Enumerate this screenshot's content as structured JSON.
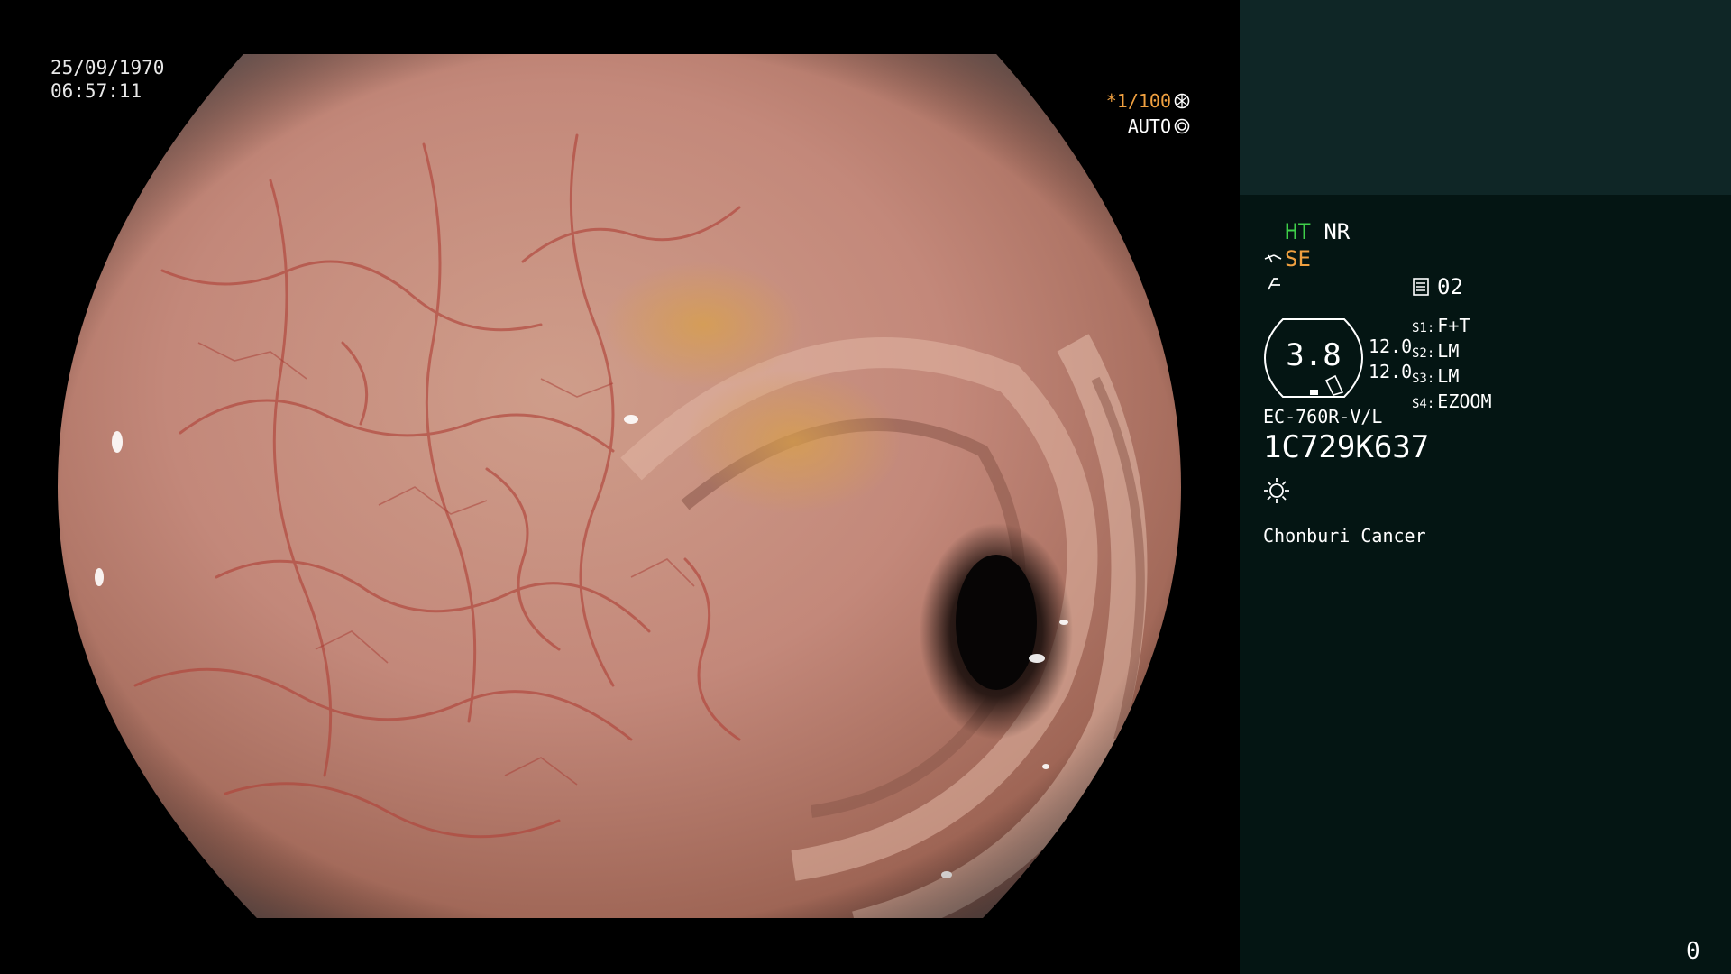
{
  "overlay": {
    "date": "25/09/1970",
    "time": "06:57:11",
    "shutter": "*1/100",
    "iris_mode": "AUTO"
  },
  "panel": {
    "ht": "HT",
    "nr": "NR",
    "se": "SE",
    "page": "02",
    "zoom_value": "3.8",
    "value_1": "12.0",
    "value_2": "12.0",
    "switches": [
      {
        "key": "S1:",
        "value": "F+T"
      },
      {
        "key": "S2:",
        "value": "LM"
      },
      {
        "key": "S3:",
        "value": "LM"
      },
      {
        "key": "S4:",
        "value": "EZOOM"
      }
    ],
    "scope_model": "EC-760R-V/L",
    "scope_serial": "1C729K637",
    "institution": "Chonburi Cancer",
    "frame_count": "0"
  },
  "colors": {
    "accent_green": "#3fd04a",
    "accent_orange": "#f0a040",
    "panel_bg": "#041513",
    "panel_top_bg": "#0f2626"
  },
  "icons": [
    "aperture-icon",
    "iris-icon",
    "scope-tip-icon",
    "enhance-icon",
    "page-icon",
    "light-source-icon"
  ]
}
